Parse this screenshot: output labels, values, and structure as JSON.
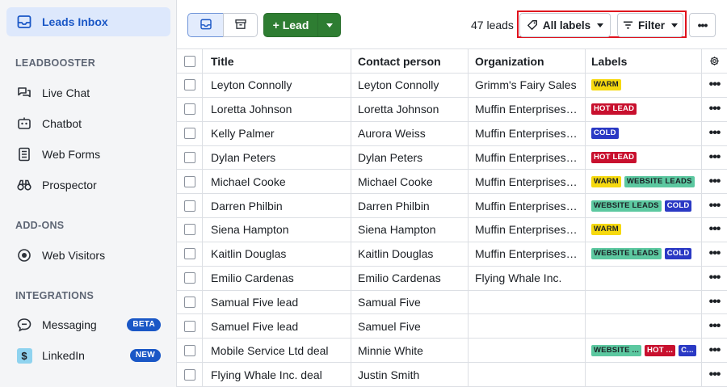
{
  "colors": {
    "accent_blue": "#1a57c6",
    "lead_green": "#2e7d32",
    "highlight_red": "#e0121d",
    "warm": "#f6d90f",
    "hot_lead": "#c8102e",
    "cold": "#2a39c4",
    "website_leads": "#5cc8a0"
  },
  "sidebar": {
    "active_item": {
      "label": "Leads Inbox",
      "icon": "inbox-icon"
    },
    "sections": [
      {
        "title": "LEADBOOSTER",
        "items": [
          {
            "label": "Live Chat",
            "icon": "chat-bubbles-icon"
          },
          {
            "label": "Chatbot",
            "icon": "chatbot-icon"
          },
          {
            "label": "Web Forms",
            "icon": "web-forms-icon"
          },
          {
            "label": "Prospector",
            "icon": "binoculars-icon"
          }
        ]
      },
      {
        "title": "ADD-ONS",
        "items": [
          {
            "label": "Web Visitors",
            "icon": "target-icon"
          }
        ]
      },
      {
        "title": "INTEGRATIONS",
        "items": [
          {
            "label": "Messaging",
            "icon": "message-icon",
            "badge": "BETA"
          },
          {
            "label": "LinkedIn",
            "icon": "linkedin-icon",
            "badge": "NEW"
          }
        ]
      }
    ]
  },
  "toolbar": {
    "lead_button": "+ Lead",
    "leads_count": "47 leads",
    "labels_button": "All labels",
    "filter_button": "Filter"
  },
  "table": {
    "columns": [
      "Title",
      "Contact person",
      "Organization",
      "Labels"
    ],
    "rows": [
      {
        "title": "Leyton Connolly",
        "contact": "Leyton Connolly",
        "org": "Grimm's Fairy Sales",
        "labels": [
          {
            "text": "WARM",
            "type": "warm"
          }
        ]
      },
      {
        "title": "Loretta Johnson",
        "contact": "Loretta Johnson",
        "org": "Muffin Enterprises ...",
        "labels": [
          {
            "text": "HOT LEAD",
            "type": "hot"
          }
        ]
      },
      {
        "title": "Kelly Palmer",
        "contact": "Aurora Weiss",
        "org": "Muffin Enterprises ...",
        "labels": [
          {
            "text": "COLD",
            "type": "cold"
          }
        ]
      },
      {
        "title": "Dylan Peters",
        "contact": "Dylan Peters",
        "org": "Muffin Enterprises ...",
        "labels": [
          {
            "text": "HOT LEAD",
            "type": "hot"
          }
        ]
      },
      {
        "title": "Michael Cooke",
        "contact": "Michael Cooke",
        "org": "Muffin Enterprises ...",
        "labels": [
          {
            "text": "WARM",
            "type": "warm"
          },
          {
            "text": "WEBSITE LEADS",
            "type": "web"
          }
        ]
      },
      {
        "title": "Darren Philbin",
        "contact": "Darren Philbin",
        "org": "Muffin Enterprises ...",
        "labels": [
          {
            "text": "WEBSITE LEADS",
            "type": "web"
          },
          {
            "text": "COLD",
            "type": "cold"
          }
        ]
      },
      {
        "title": "Siena Hampton",
        "contact": "Siena Hampton",
        "org": "Muffin Enterprises ...",
        "labels": [
          {
            "text": "WARM",
            "type": "warm"
          }
        ]
      },
      {
        "title": "Kaitlin Douglas",
        "contact": "Kaitlin Douglas",
        "org": "Muffin Enterprises ...",
        "labels": [
          {
            "text": "WEBSITE LEADS",
            "type": "web"
          },
          {
            "text": "COLD",
            "type": "cold"
          }
        ]
      },
      {
        "title": "Emilio Cardenas",
        "contact": "Emilio Cardenas",
        "org": "Flying Whale Inc.",
        "labels": []
      },
      {
        "title": "Samual Five lead",
        "contact": "Samual Five",
        "org": "",
        "labels": []
      },
      {
        "title": "Samuel Five lead",
        "contact": "Samuel Five",
        "org": "",
        "labels": []
      },
      {
        "title": "Mobile Service Ltd deal",
        "contact": "Minnie White",
        "org": "",
        "labels": [
          {
            "text": "WEBSITE ...",
            "type": "web"
          },
          {
            "text": "HOT ...",
            "type": "hot"
          },
          {
            "text": "C...",
            "type": "cold"
          }
        ]
      },
      {
        "title": "Flying Whale Inc. deal",
        "contact": "Justin Smith",
        "org": "",
        "labels": []
      }
    ]
  }
}
